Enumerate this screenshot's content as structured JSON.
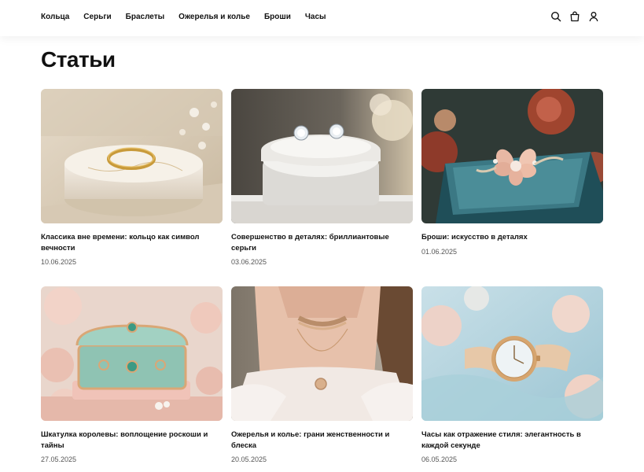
{
  "nav": {
    "items": [
      {
        "label": "Кольца"
      },
      {
        "label": "Серьги"
      },
      {
        "label": "Браслеты"
      },
      {
        "label": "Ожерелья и колье"
      },
      {
        "label": "Броши"
      },
      {
        "label": "Часы"
      }
    ]
  },
  "header_icons": [
    "search-icon",
    "cart-icon",
    "user-icon"
  ],
  "page": {
    "title": "Статьи"
  },
  "articles": [
    {
      "title": "Классика вне времени: кольцо как символ вечности",
      "date": "10.06.2025"
    },
    {
      "title": "Совершенство в деталях: бриллиантовые серьги",
      "date": "03.06.2025"
    },
    {
      "title": "Броши: искусство в деталях",
      "date": "01.06.2025"
    },
    {
      "title": "Шкатулка королевы: воплощение роскоши и тайны",
      "date": "27.05.2025"
    },
    {
      "title": "Ожерелья и колье: грани женственности и блеска",
      "date": "20.05.2025"
    },
    {
      "title": "Часы как отражение стиля: элегантность в каждой секунде",
      "date": "06.05.2025"
    }
  ]
}
